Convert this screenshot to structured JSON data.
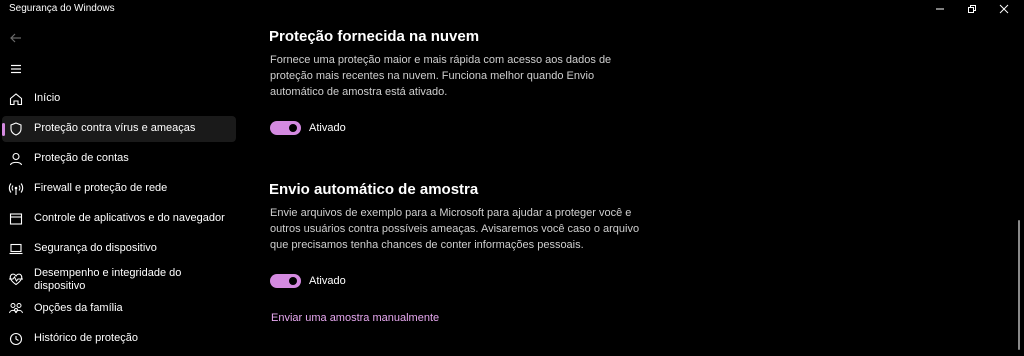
{
  "window": {
    "title": "Segurança do Windows"
  },
  "colors": {
    "accent": "#d48ae0",
    "link": "#e7a8f0",
    "background": "#000000",
    "selected_bg": "#1a1a1a"
  },
  "sidebar": {
    "items": [
      {
        "label": "Início",
        "icon": "home-icon",
        "selected": false
      },
      {
        "label": "Proteção contra vírus e ameaças",
        "icon": "shield-icon",
        "selected": true
      },
      {
        "label": "Proteção de contas",
        "icon": "person-icon",
        "selected": false
      },
      {
        "label": "Firewall e proteção de rede",
        "icon": "antenna-icon",
        "selected": false
      },
      {
        "label": "Controle de aplicativos e do navegador",
        "icon": "app-window-icon",
        "selected": false
      },
      {
        "label": "Segurança do dispositivo",
        "icon": "laptop-icon",
        "selected": false
      },
      {
        "label": "Desempenho e integridade do dispositivo",
        "icon": "heart-pulse-icon",
        "selected": false
      },
      {
        "label": "Opções da família",
        "icon": "family-icon",
        "selected": false
      },
      {
        "label": "Histórico de proteção",
        "icon": "history-icon",
        "selected": false
      }
    ]
  },
  "main": {
    "cloud": {
      "title": "Proteção fornecida na nuvem",
      "lines": [
        "Fornece uma proteção maior e mais rápida com acesso aos dados de",
        "proteção mais recentes na nuvem. Funciona melhor quando Envio",
        "automático de amostra está ativado."
      ],
      "toggle_label": "Ativado",
      "toggle_on": true
    },
    "sample": {
      "title": "Envio automático de amostra",
      "lines": [
        "Envie arquivos de exemplo para a Microsoft para ajudar a proteger você e",
        "outros usuários contra possíveis ameaças. Avisaremos você caso o arquivo",
        "que precisamos tenha chances de conter informações pessoais."
      ],
      "toggle_label": "Ativado",
      "toggle_on": true,
      "link": "Enviar uma amostra manualmente"
    }
  }
}
